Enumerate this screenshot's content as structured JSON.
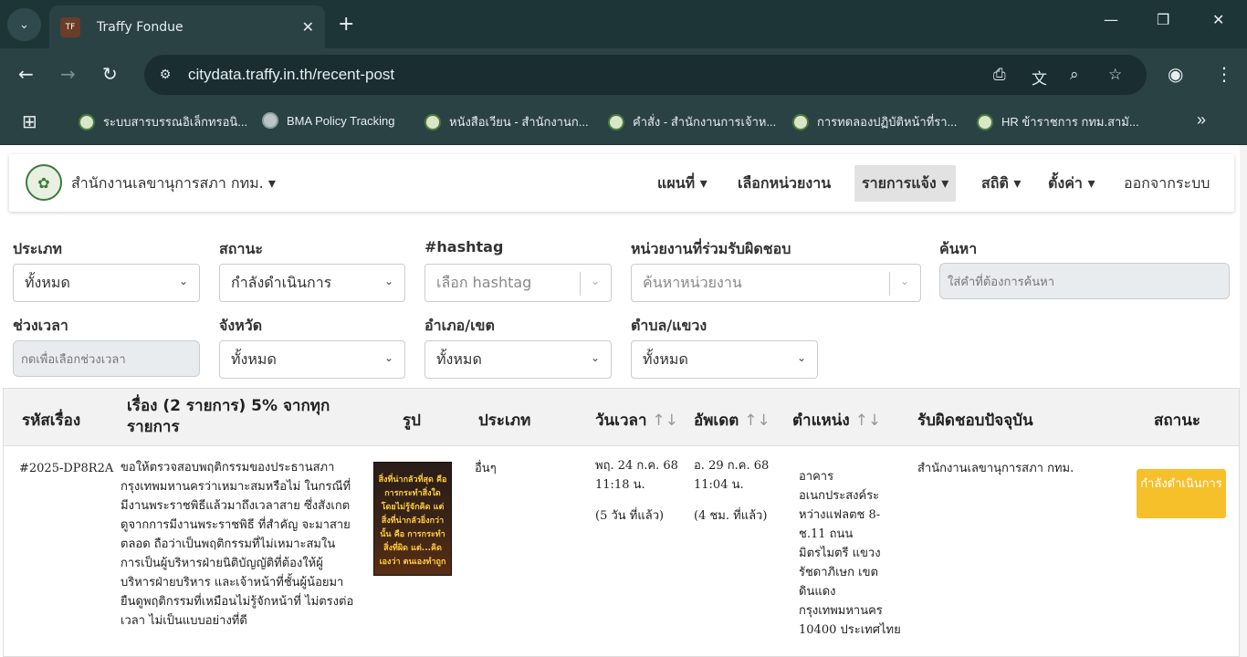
{
  "browser": {
    "tab_title": "Traffy Fondue",
    "url": "citydata.traffy.in.th/recent-post",
    "bookmarks": [
      "ระบบสารบรรณอิเล็กทรอนิ...",
      "BMA Policy Tracking",
      "หนังสือเวียน - สำนักงานก...",
      "คำสั่ง - สำนักงานการเจ้าห...",
      "การทดลองปฏิบัติหน้าที่รา...",
      "HR ข้าราชการ กทม.สามั..."
    ],
    "more_bookmarks": "»"
  },
  "nav": {
    "org_name": "สำนักงานเลขานุการสภา กทม.",
    "menu": {
      "map": "แผนที่",
      "select_unit": "เลือกหน่วยงาน",
      "reports": "รายการแจ้ง",
      "stats": "สถิติ",
      "settings": "ตั้งค่า",
      "logout": "ออกจากระบบ"
    }
  },
  "filters": {
    "type": {
      "label": "ประเภท",
      "value": "ทั้งหมด"
    },
    "status": {
      "label": "สถานะ",
      "value": "กำลังดำเนินการ"
    },
    "hashtag": {
      "label": "#hashtag",
      "placeholder": "เลือก hashtag"
    },
    "co_units": {
      "label": "หน่วยงานที่ร่วมรับผิดชอบ",
      "placeholder": "ค้นหาหน่วยงาน"
    },
    "search": {
      "label": "ค้นหา",
      "placeholder": "ใส่คำที่ต้องการค้นหา"
    },
    "time_range": {
      "label": "ช่วงเวลา",
      "placeholder": "กดเพื่อเลือกช่วงเวลา"
    },
    "province": {
      "label": "จังหวัด",
      "value": "ทั้งหมด"
    },
    "district": {
      "label": "อำเภอ/เขต",
      "value": "ทั้งหมด"
    },
    "subdistrict": {
      "label": "ตำบล/แขวง",
      "value": "ทั้งหมด"
    }
  },
  "table": {
    "headers": {
      "id": "รหัสเรื่อง",
      "story": "เรื่อง (2 รายการ) 5% จากทุกรายการ",
      "photo": "รูป",
      "type": "ประเภท",
      "datetime": "วันเวลา",
      "updated": "อัพเดต",
      "location": "ตำแหน่ง",
      "responsible": "รับผิดชอบปัจจุบัน",
      "status": "สถานะ"
    },
    "sort_icon": "↑↓",
    "rows": [
      {
        "id": "#2025-DP8R2A",
        "story": "ขอให้ตรวจสอบพฤติกรรมของประธานสภากรุงเทพมหานครว่าเหมาะสมหรือไม่ ในกรณีที่มีงานพระราชพิธีแล้วมาถึงเวลาสาย ซึ่งสังเกตดูจากการมีงานพระราชพิธี ที่สำคัญ จะมาสายตลอด ถือว่าเป็นพฤติกรรมที่ไม่เหมาะสมในการเป็นผู้บริหารฝ่ายนิติบัญญัติที่ต้องให้ผู้บริหารฝ่ายบริหาร และเจ้าหน้าที่ชั้นผู้น้อยมายืนดูพฤติกรรมที่เหมือนไม่รู้จักหน้าที่ ไม่ตรงต่อเวลา ไม่เป็นแบบอย่างที่ดี",
        "photo_text": "สิ่งที่น่ากลัวที่สุด คือ การกระทำสิ่งใด โดยไม่รู้จักคิด แต่สิ่งที่น่ากลัวยิ่งกว่านั้น คือ การกระทำสิ่งที่ผิด แต่...คิดเองว่า ตนเองทำถูก",
        "type": "อื่นๆ",
        "date": "พฤ. 24 ก.ค. 68",
        "time": "11:18 น.",
        "date_ago": "(5 วัน ที่แล้ว)",
        "updated_date": "อ. 29 ก.ค. 68",
        "updated_time": "11:04 น.",
        "updated_ago": "(4 ชม. ที่แล้ว)",
        "location": "อาคาร อเนกประสงค์ระหว่างแฟลตช 8-ช.11 ถนน มิตรไมตรี แขวง รัชดาภิเษก เขต ดินแดง กรุงเทพมหานคร 10400 ประเทศไทย",
        "responsible": "สำนักงานเลขานุการสภา กทม.",
        "status": "กำลังดำเนินการ"
      }
    ]
  }
}
